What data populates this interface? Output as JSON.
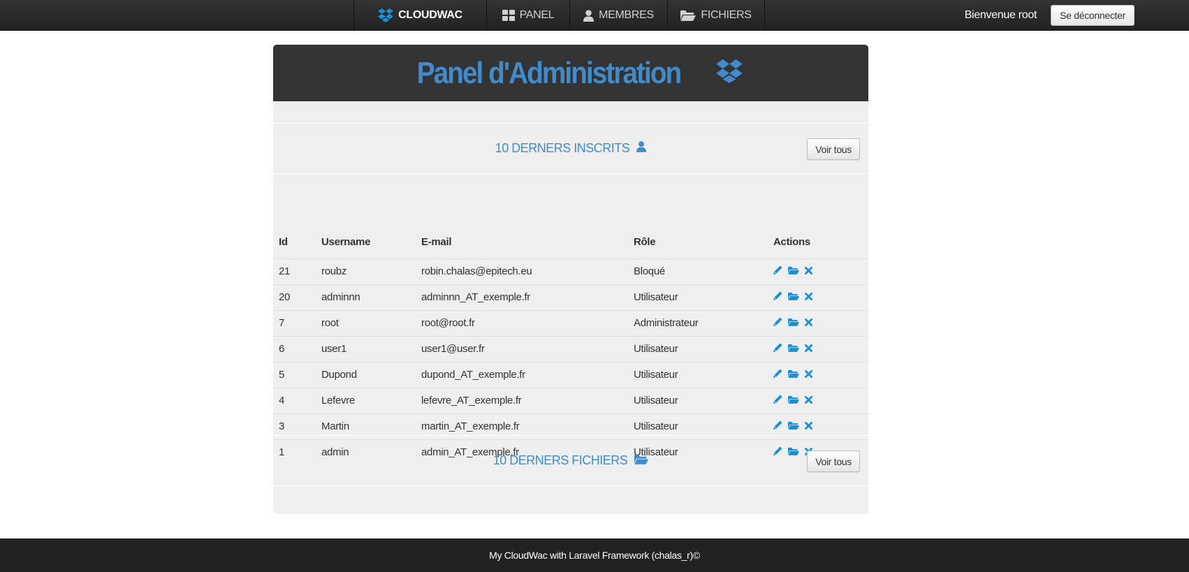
{
  "colors": {
    "accent": "#428bca",
    "navbar": "#222222",
    "panel_header": "#333333",
    "panel_body": "#efefef",
    "action_icon": "#1a8fd8"
  },
  "nav": {
    "brand": "CLOUDWAC",
    "brand_icon": "dropbox-icon",
    "links": [
      {
        "label": "PANEL",
        "icon": "th-large-icon"
      },
      {
        "label": "MEMBRES",
        "icon": "user-icon"
      },
      {
        "label": "FICHIERS",
        "icon": "folder-open-icon"
      }
    ],
    "welcome": "Bienvenue root",
    "logout": "Se déconnecter"
  },
  "panel": {
    "title": "Panel d'Administration",
    "title_icon": "dropbox-icon"
  },
  "members_section": {
    "title": "10 DERNERS INSCRITS",
    "icon": "user-icon",
    "button": "Voir tous"
  },
  "files_section": {
    "title": "10 DERNERS FICHIERS",
    "icon": "folder-open-icon",
    "button": "Voir tous"
  },
  "table": {
    "headers": [
      "Id",
      "Username",
      "E-mail",
      "Rôle",
      "Actions"
    ],
    "action_icons": [
      "pencil-icon",
      "folder-open-icon",
      "close-icon"
    ],
    "rows": [
      {
        "id": "21",
        "username": "roubz",
        "email": "robin.chalas@epitech.eu",
        "role": "Bloqué"
      },
      {
        "id": "20",
        "username": "adminnn",
        "email": "adminnn_AT_exemple.fr",
        "role": "Utilisateur"
      },
      {
        "id": "7",
        "username": "root",
        "email": "root@root.fr",
        "role": "Administrateur"
      },
      {
        "id": "6",
        "username": "user1",
        "email": "user1@user.fr",
        "role": "Utilisateur"
      },
      {
        "id": "5",
        "username": "Dupond",
        "email": "dupond_AT_exemple.fr",
        "role": "Utilisateur"
      },
      {
        "id": "4",
        "username": "Lefevre",
        "email": "lefevre_AT_exemple.fr",
        "role": "Utilisateur"
      },
      {
        "id": "3",
        "username": "Martin",
        "email": "martin_AT_exemple.fr",
        "role": "Utilisateur"
      },
      {
        "id": "1",
        "username": "admin",
        "email": "admin_AT_exemple.fr",
        "role": "Utilisateur"
      }
    ]
  },
  "footer": {
    "text": "My CloudWac with Laravel Framework  (chalas_r)©"
  }
}
